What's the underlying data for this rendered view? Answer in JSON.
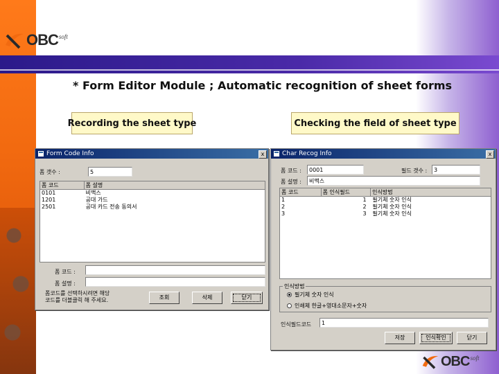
{
  "logo": {
    "text": "OBC",
    "suffix": "soft"
  },
  "heading": "* Form Editor Module ; Automatic recognition of sheet forms",
  "labels": {
    "left": "Recording the sheet type",
    "right": "Checking the field of sheet type"
  },
  "form_code_window": {
    "title": "Form Code Info",
    "close": "x",
    "form_count_label": "폼 갯수 :",
    "form_count_value": "5",
    "columns": [
      "폼 코드",
      "폼 설명"
    ],
    "rows": [
      [
        "0101",
        "비맥스"
      ],
      [
        "1201",
        "공대 가드"
      ],
      [
        "2501",
        "공대 카드 전송 동의서"
      ]
    ],
    "form_code_label": "폼 코드 :",
    "form_desc_label": "폼 설명 :",
    "form_code_value": "",
    "form_desc_value": "",
    "hint_line1": "폼코드를 선택하시려면 해당",
    "hint_line2": "코드를 더블클릭 해 주세요.",
    "buttons": [
      "조회",
      "삭제",
      "닫기"
    ]
  },
  "char_recog_window": {
    "title": "Char Recog Info",
    "close": "x",
    "form_code_label": "폼 코드 :",
    "form_code_value": "0001",
    "field_count_label": "필드 갯수 :",
    "field_count_value": "3",
    "form_name_label": "폼 설명 :",
    "form_name_value": "비맥스",
    "columns": [
      "폼 코드",
      "폼 인식필드",
      "인식방법"
    ],
    "rows": [
      [
        "1",
        "1",
        "필기체 숫자 인식"
      ],
      [
        "2",
        "2",
        "필기체 숫자 인식"
      ],
      [
        "3",
        "3",
        "필기체 숫자 인식"
      ]
    ],
    "group_label": "인식방법",
    "radio_1": "필기체 숫자 인식",
    "radio_2": "인쇄체 한글+영대소문자+숫자",
    "radio_1_checked": true,
    "recog_field_label": "인식필드코드",
    "recog_field_value": "1",
    "buttons": [
      "저장",
      "인식확인",
      "닫기"
    ]
  },
  "colors": {
    "accent_purple": "#4a2aa8",
    "accent_orange": "#f26a10",
    "label_yellow": "#fff9c8",
    "window_gray": "#d4d0c8",
    "title_blue": "#0a246a"
  }
}
